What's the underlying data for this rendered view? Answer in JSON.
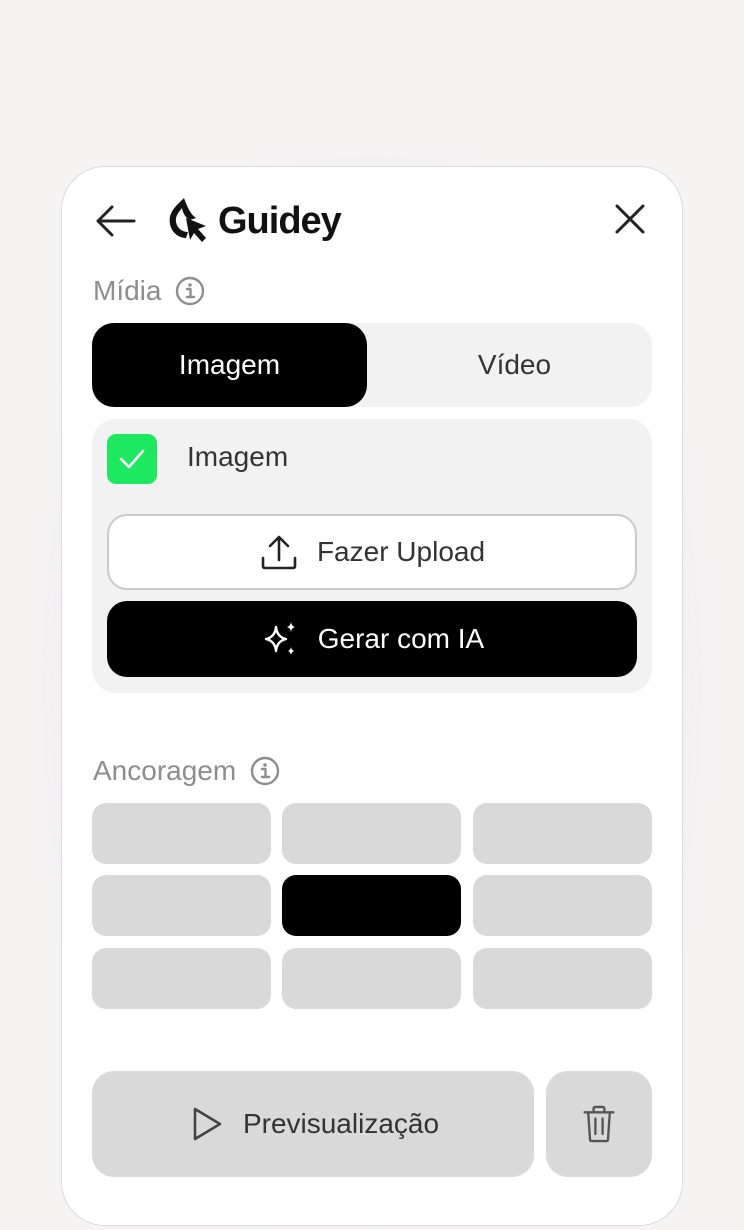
{
  "brand": {
    "name": "Guidey"
  },
  "media": {
    "label": "Mídia",
    "tabs": [
      {
        "label": "Imagem",
        "active": true
      },
      {
        "label": "Vídeo",
        "active": false
      }
    ],
    "image_toggle": {
      "label": "Imagem",
      "checked": true
    },
    "upload_label": "Fazer Upload",
    "ai_label": "Gerar com IA"
  },
  "anchoring": {
    "label": "Ancoragem",
    "selected": "middle-center",
    "positions": [
      "top-left",
      "top-center",
      "top-right",
      "middle-left",
      "middle-center",
      "middle-right",
      "bottom-left",
      "bottom-center",
      "bottom-right"
    ]
  },
  "footer": {
    "preview_label": "Previsualização"
  },
  "colors": {
    "accent_check": "#1ee860",
    "primary": "#000000",
    "muted": "#d9d9d9"
  },
  "icons": [
    "arrow-left-icon",
    "guidey-logo-icon",
    "close-icon",
    "info-icon",
    "checkmark-icon",
    "upload-icon",
    "sparkles-icon",
    "play-icon",
    "trash-icon"
  ]
}
